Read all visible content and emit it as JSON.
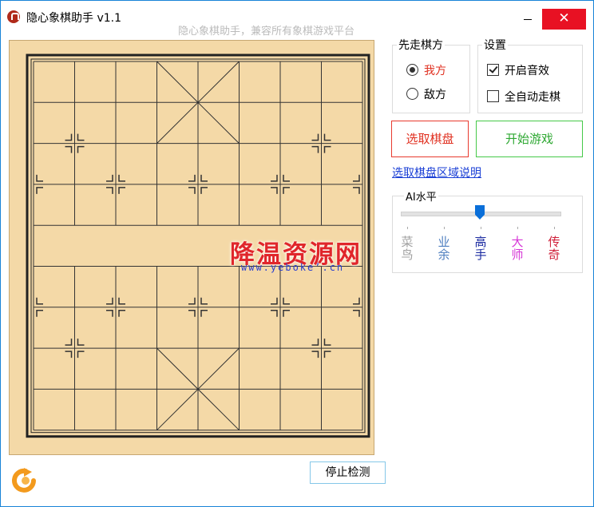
{
  "window": {
    "title": "隐心象棋助手 v1.1",
    "subtitle": "隐心象棋助手，兼容所有象棋游戏平台",
    "close_glyph": "✕",
    "accent": "#1883d7"
  },
  "board": {
    "watermark_text": "降温资源网",
    "watermark_url": "www.yebokeʼ.cn"
  },
  "first_move": {
    "label": "先走棋方",
    "options": [
      {
        "label": "我方",
        "checked": true,
        "color": "#e03020"
      },
      {
        "label": "敌方",
        "checked": false,
        "color": "#000000"
      }
    ]
  },
  "settings": {
    "label": "设置",
    "options": [
      {
        "label": "开启音效",
        "checked": true
      },
      {
        "label": "全自动走棋",
        "checked": false
      }
    ]
  },
  "buttons": {
    "select_board": "选取棋盘",
    "start_game": "开始游戏",
    "stop_detect": "停止检测"
  },
  "help_link": "选取棋盘区域说明",
  "ai_level": {
    "label": "AI水平",
    "current_index": 2,
    "levels": [
      {
        "label": "菜鸟",
        "color": "#a0a0a0"
      },
      {
        "label": "业余",
        "color": "#4f7fc0"
      },
      {
        "label": "高手",
        "color": "#1a2aa0"
      },
      {
        "label": "大师",
        "color": "#d636d6"
      },
      {
        "label": "传奇",
        "color": "#d0203a"
      }
    ]
  },
  "icons": {
    "app": "app-icon",
    "refresh": "refresh-icon"
  }
}
